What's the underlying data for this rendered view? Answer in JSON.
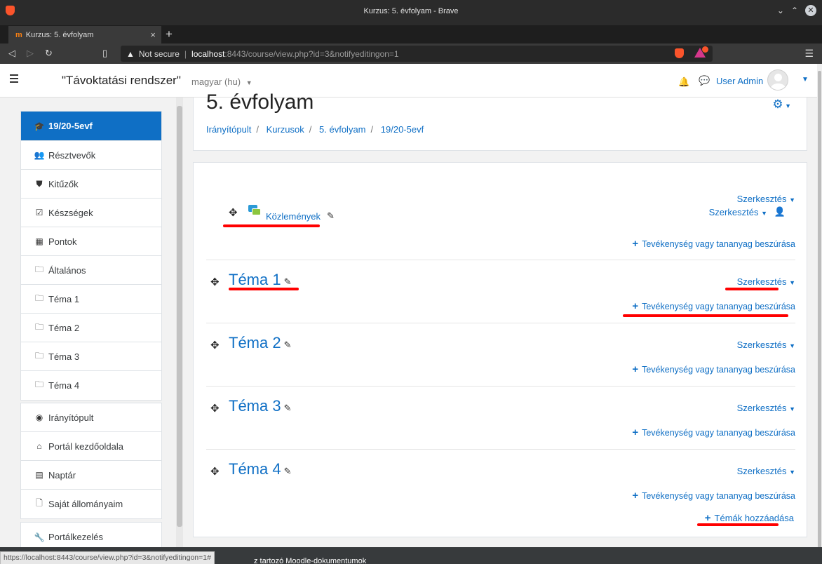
{
  "browser": {
    "window_title": "Kurzus: 5. évfolyam - Brave",
    "tab_favicon": "m",
    "tab_title": "Kurzus: 5. évfolyam",
    "new_tab": "+",
    "security_label": "Not secure",
    "url_host": "localhost",
    "url_path": ":8443/course/view.php?id=3&notifyeditingon=1",
    "status_url": "https://localhost:8443/course/view.php?id=3&notifyeditingon=1#"
  },
  "navbar": {
    "site_name": "\"Távoktatási rendszer\"",
    "language": "magyar (hu)",
    "user_name": "User Admin"
  },
  "drawer": {
    "group1": [
      {
        "icon": "graduation-cap-icon",
        "glyph": "🎓",
        "label": "19/20-5evf",
        "active": true
      },
      {
        "icon": "users-icon",
        "glyph": "👥",
        "label": "Résztvevők"
      },
      {
        "icon": "shield-icon",
        "glyph": "⛊",
        "label": "Kitűzők"
      },
      {
        "icon": "check-square-icon",
        "glyph": "☑",
        "label": "Készségek"
      },
      {
        "icon": "table-icon",
        "glyph": "▦",
        "label": "Pontok"
      },
      {
        "icon": "folder-icon",
        "glyph": "🗀",
        "label": "Általános"
      },
      {
        "icon": "folder-icon",
        "glyph": "🗀",
        "label": "Téma 1"
      },
      {
        "icon": "folder-icon",
        "glyph": "🗀",
        "label": "Téma 2"
      },
      {
        "icon": "folder-icon",
        "glyph": "🗀",
        "label": "Téma 3"
      },
      {
        "icon": "folder-icon",
        "glyph": "🗀",
        "label": "Téma 4"
      }
    ],
    "group2": [
      {
        "icon": "dashboard-icon",
        "glyph": "◉",
        "label": "Irányítópult"
      },
      {
        "icon": "home-icon",
        "glyph": "⌂",
        "label": "Portál kezdőoldala"
      },
      {
        "icon": "calendar-icon",
        "glyph": "▤",
        "label": "Naptár"
      },
      {
        "icon": "file-icon",
        "glyph": "🗋",
        "label": "Saját állományaim"
      }
    ],
    "group3": [
      {
        "icon": "wrench-icon",
        "glyph": "🔧",
        "label": "Portálkezelés"
      }
    ]
  },
  "course": {
    "title": "5. évfolyam",
    "breadcrumb": [
      "Irányítópult",
      "Kurzusok",
      "5. évfolyam",
      "19/20-5evf"
    ]
  },
  "general_section": {
    "edit_label": "Szerkesztés",
    "activity_name": "Közlemények",
    "activity_edit_label": "Szerkesztés",
    "add_label": "Tevékenység vagy tananyag beszúrása"
  },
  "sections": [
    {
      "title": "Téma 1",
      "edit_label": "Szerkesztés",
      "add_label": "Tevékenység vagy tananyag beszúrása"
    },
    {
      "title": "Téma 2",
      "edit_label": "Szerkesztés",
      "add_label": "Tevékenység vagy tananyag beszúrása"
    },
    {
      "title": "Téma 3",
      "edit_label": "Szerkesztés",
      "add_label": "Tevékenység vagy tananyag beszúrása"
    },
    {
      "title": "Téma 4",
      "edit_label": "Szerkesztés",
      "add_label": "Tevékenység vagy tananyag beszúrása"
    }
  ],
  "add_sections_label": "Témák hozzáadása",
  "footer_text": "z tartozó Moodle-dokumentumok",
  "colors": {
    "accent": "#0f6fc5",
    "annotation": "#ff0000",
    "chrome": "#2b2b2b"
  }
}
